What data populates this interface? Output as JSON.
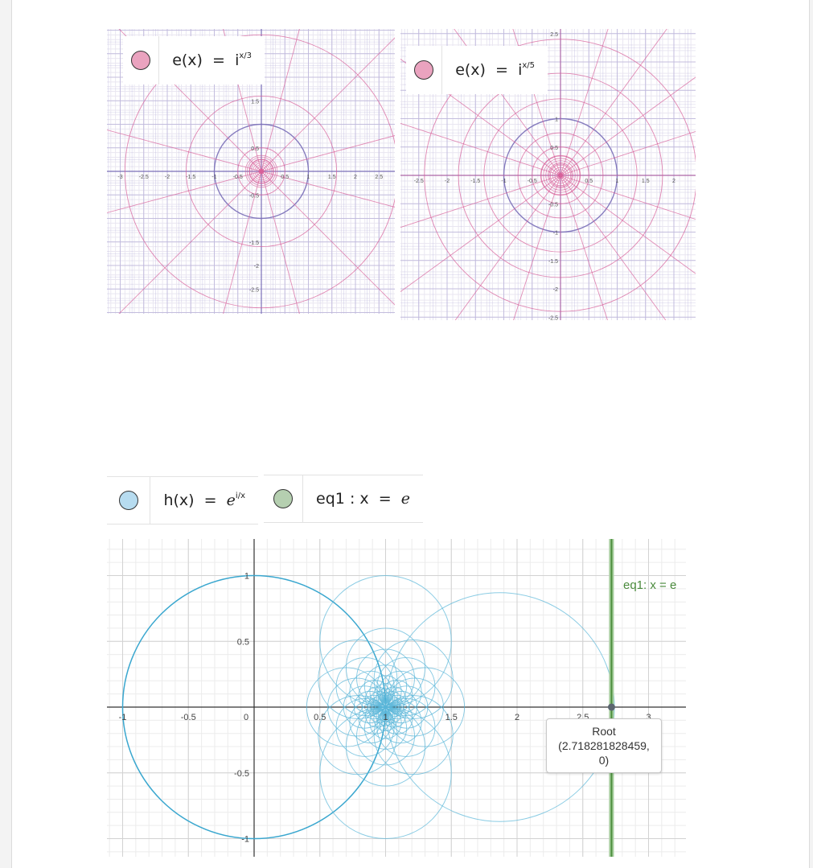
{
  "colors": {
    "pink": "#d8609a",
    "violet": "#7a6fb8",
    "blue": "#5ab6d8",
    "green": "#4d8f3f",
    "point": "#5c6670"
  },
  "panel1": {
    "legend_func": "e(x)",
    "legend_eq": "=",
    "legend_base": "i",
    "legend_exp": "x/3",
    "dot_color": "#eaa3bf",
    "ticks_x": [
      "-3",
      "-2.5",
      "-2",
      "-1.5",
      "-1",
      "-0.5",
      "0.5",
      "1",
      "1.5",
      "2",
      "2.5",
      "3"
    ],
    "ticks_y": [
      "1.5",
      "0.5",
      "-0.5",
      "-1.5",
      "-2",
      "-2.5"
    ]
  },
  "panel2": {
    "legend_func": "e(x)",
    "legend_eq": "=",
    "legend_base": "i",
    "legend_exp": "x/5",
    "dot_color": "#eaa3bf",
    "ticks_x": [
      "-2.5",
      "-2",
      "-1.5",
      "-1",
      "-0.5",
      "0.5",
      "1",
      "1.5",
      "2",
      "2.5"
    ],
    "ticks_y": [
      "2.5",
      "1",
      "0.5",
      "-0.5",
      "-1",
      "-1.5",
      "-2",
      "-2.5"
    ]
  },
  "legend_h": {
    "func": "h(x)",
    "eq": "=",
    "base": "e",
    "exp": "i/x",
    "dot_color": "#b7dcf0"
  },
  "legend_eq1": {
    "name": "eq1",
    "colon": ":",
    "lhs": "x",
    "eq": "=",
    "rhs": "e",
    "dot_color": "#b5cfb0"
  },
  "panel3": {
    "ticks_x": [
      "-1",
      "-0.5",
      "0",
      "0.5",
      "1",
      "1.5",
      "2",
      "2.5",
      "3"
    ],
    "ticks_y": [
      "1",
      "0.5",
      "-0.5",
      "-1"
    ],
    "eq_label": "eq1: x = e",
    "root_title": "Root",
    "root_coords": "(2.718281828459, 0)"
  }
}
